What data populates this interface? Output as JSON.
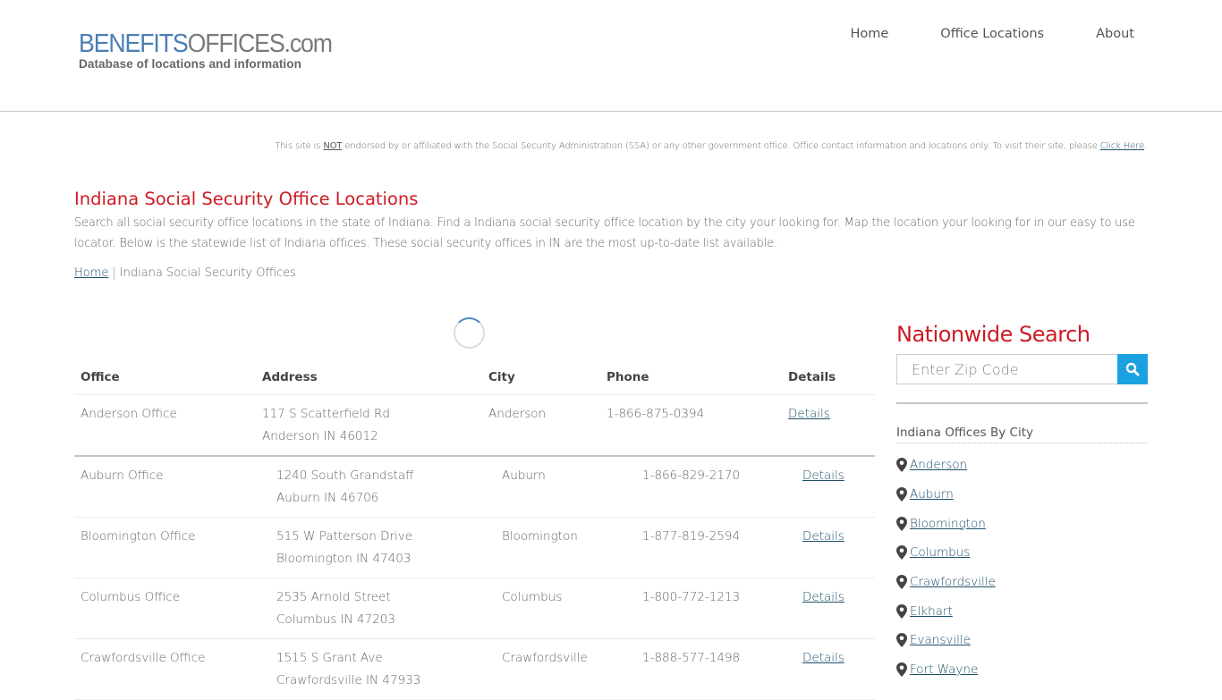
{
  "header": {
    "logo_part1": "BENEFITS",
    "logo_part2": "OFFICES.com",
    "logo_tagline": "Database of locations and information",
    "nav": [
      {
        "label": "Home"
      },
      {
        "label": "Office Locations"
      },
      {
        "label": "About"
      }
    ]
  },
  "disclaimer": {
    "prefix": "This site is ",
    "not": "NOT",
    "middle": " endorsed by or affiliated with the Social Security Administration (SSA) or any other government office. Office contact information and locations only. To visit their site, please ",
    "link": "Click Here",
    "suffix": "."
  },
  "main": {
    "title": "Indiana Social Security Office Locations",
    "intro": "Search all social security office locations in the state of Indiana. Find a Indiana social security office location by the city your looking for. Map the location your looking for in our easy to use locator. Below is the statewide list of Indiana offices. These social security offices in IN are the most up-to-date list available.",
    "breadcrumb": {
      "home": "Home",
      "separator": "|",
      "current": "Indiana Social Security Offices"
    }
  },
  "table": {
    "headers": [
      "Office",
      "Address",
      "City",
      "Phone",
      "Details"
    ],
    "first_row": {
      "office": "Anderson Office",
      "address1": "117 S Scatterfield Rd",
      "address2": "Anderson IN 46012",
      "city": "Anderson",
      "phone": "1-866-875-0394",
      "details": "Details"
    },
    "rows": [
      {
        "office": "Auburn Office",
        "address1": "1240 South Grandstaff",
        "address2": "Auburn IN 46706",
        "city": "Auburn",
        "phone": "1-866-829-2170",
        "details": "Details"
      },
      {
        "office": "Bloomington Office",
        "address1": "515 W Patterson Drive",
        "address2": "Bloomington IN 47403",
        "city": "Bloomington",
        "phone": "1-877-819-2594",
        "details": "Details"
      },
      {
        "office": "Columbus Office",
        "address1": "2535 Arnold Street",
        "address2": "Columbus IN 47203",
        "city": "Columbus",
        "phone": "1-800-772-1213",
        "details": "Details"
      },
      {
        "office": "Crawfordsville Office",
        "address1": "1515 S Grant Ave",
        "address2": "Crawfordsville IN 47933",
        "city": "Crawfordsville",
        "phone": "1-888-577-1498",
        "details": "Details"
      }
    ]
  },
  "sidebar": {
    "title": "Nationwide Search",
    "zip_placeholder": "Enter Zip Code",
    "zip_value": "",
    "search_icon": "search-icon",
    "city_heading": "Indiana Offices By City",
    "city_icon": "map-marker-icon",
    "cities": [
      "Anderson",
      "Auburn",
      "Bloomington",
      "Columbus",
      "Crawfordsville",
      "Elkhart",
      "Evansville",
      "Fort Wayne"
    ]
  },
  "colors": {
    "accent_red": "#cc1c24",
    "search_button": "#1ba1e2",
    "logo_blue": "#4a7eb5",
    "link": "#1d4f6b"
  }
}
